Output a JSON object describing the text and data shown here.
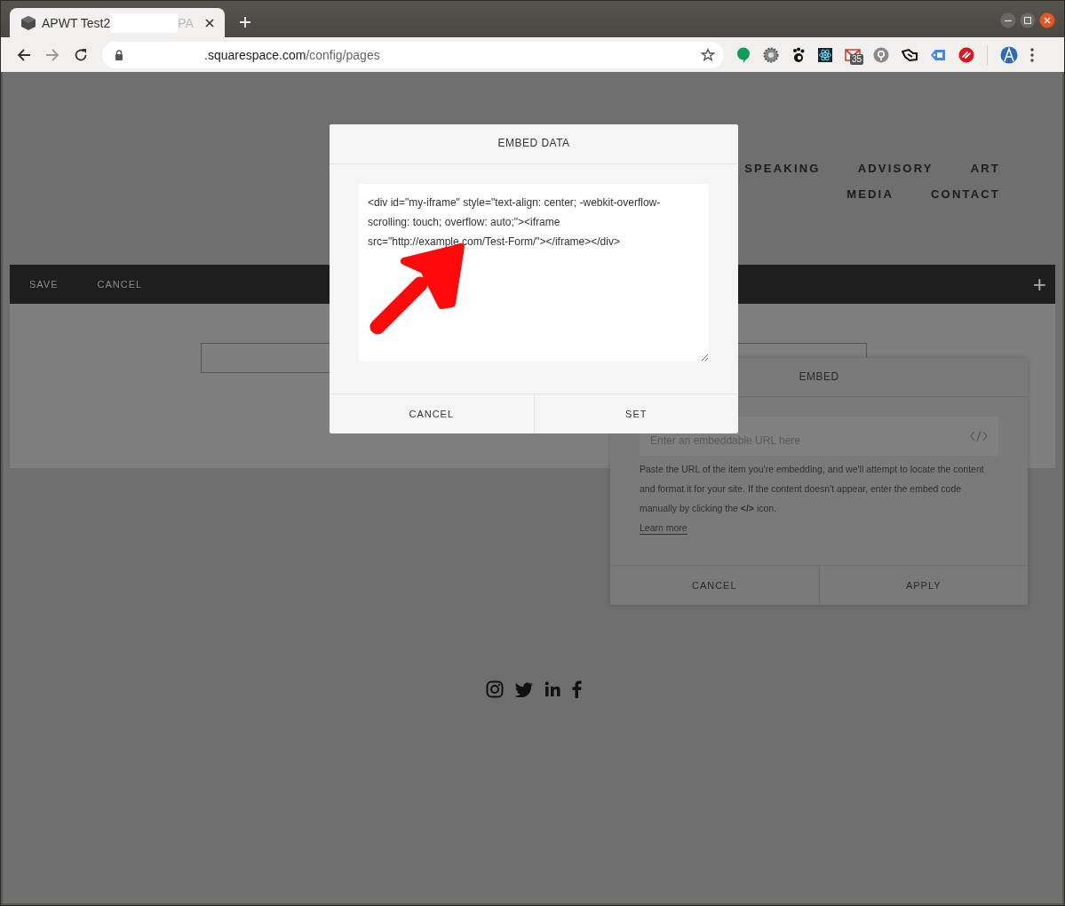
{
  "browser": {
    "tab": {
      "title": "APWT Test2",
      "title_tail": "PA"
    },
    "address": {
      "host": ".squarespace.com",
      "path": "/config/pages"
    },
    "mail_badge": "35"
  },
  "site_nav": [
    [
      {
        "label": "SPEAKING"
      },
      {
        "label": "ADVISORY"
      },
      {
        "label": "ART"
      }
    ],
    [
      {
        "label": "MEDIA"
      },
      {
        "label": "CONTACT"
      }
    ]
  ],
  "editor_bar": {
    "buttons": [
      "SAVE",
      "CANCEL"
    ],
    "add": "+"
  },
  "embed_panel": {
    "title": "EMBED",
    "url_field": {
      "placeholder": "Enter an embeddable URL here"
    },
    "help": "Paste the URL of the item you're embedding, and we'll attempt to locate the content and format it for your site. If the content doesn't appear, enter the embed code manually by clicking the **</>** icon.",
    "learn_more": "Learn more",
    "buttons": [
      "CANCEL",
      "APPLY"
    ]
  },
  "embed_data_dialog": {
    "title": "EMBED DATA",
    "code": "<div id=\"my-iframe\" style=\"text-align: center; -webkit-overflow-scrolling: touch; overflow: auto;\"><iframe src=\"http://example.com/Test-Form/\"></iframe></div>",
    "buttons": [
      "CANCEL",
      "SET"
    ]
  }
}
